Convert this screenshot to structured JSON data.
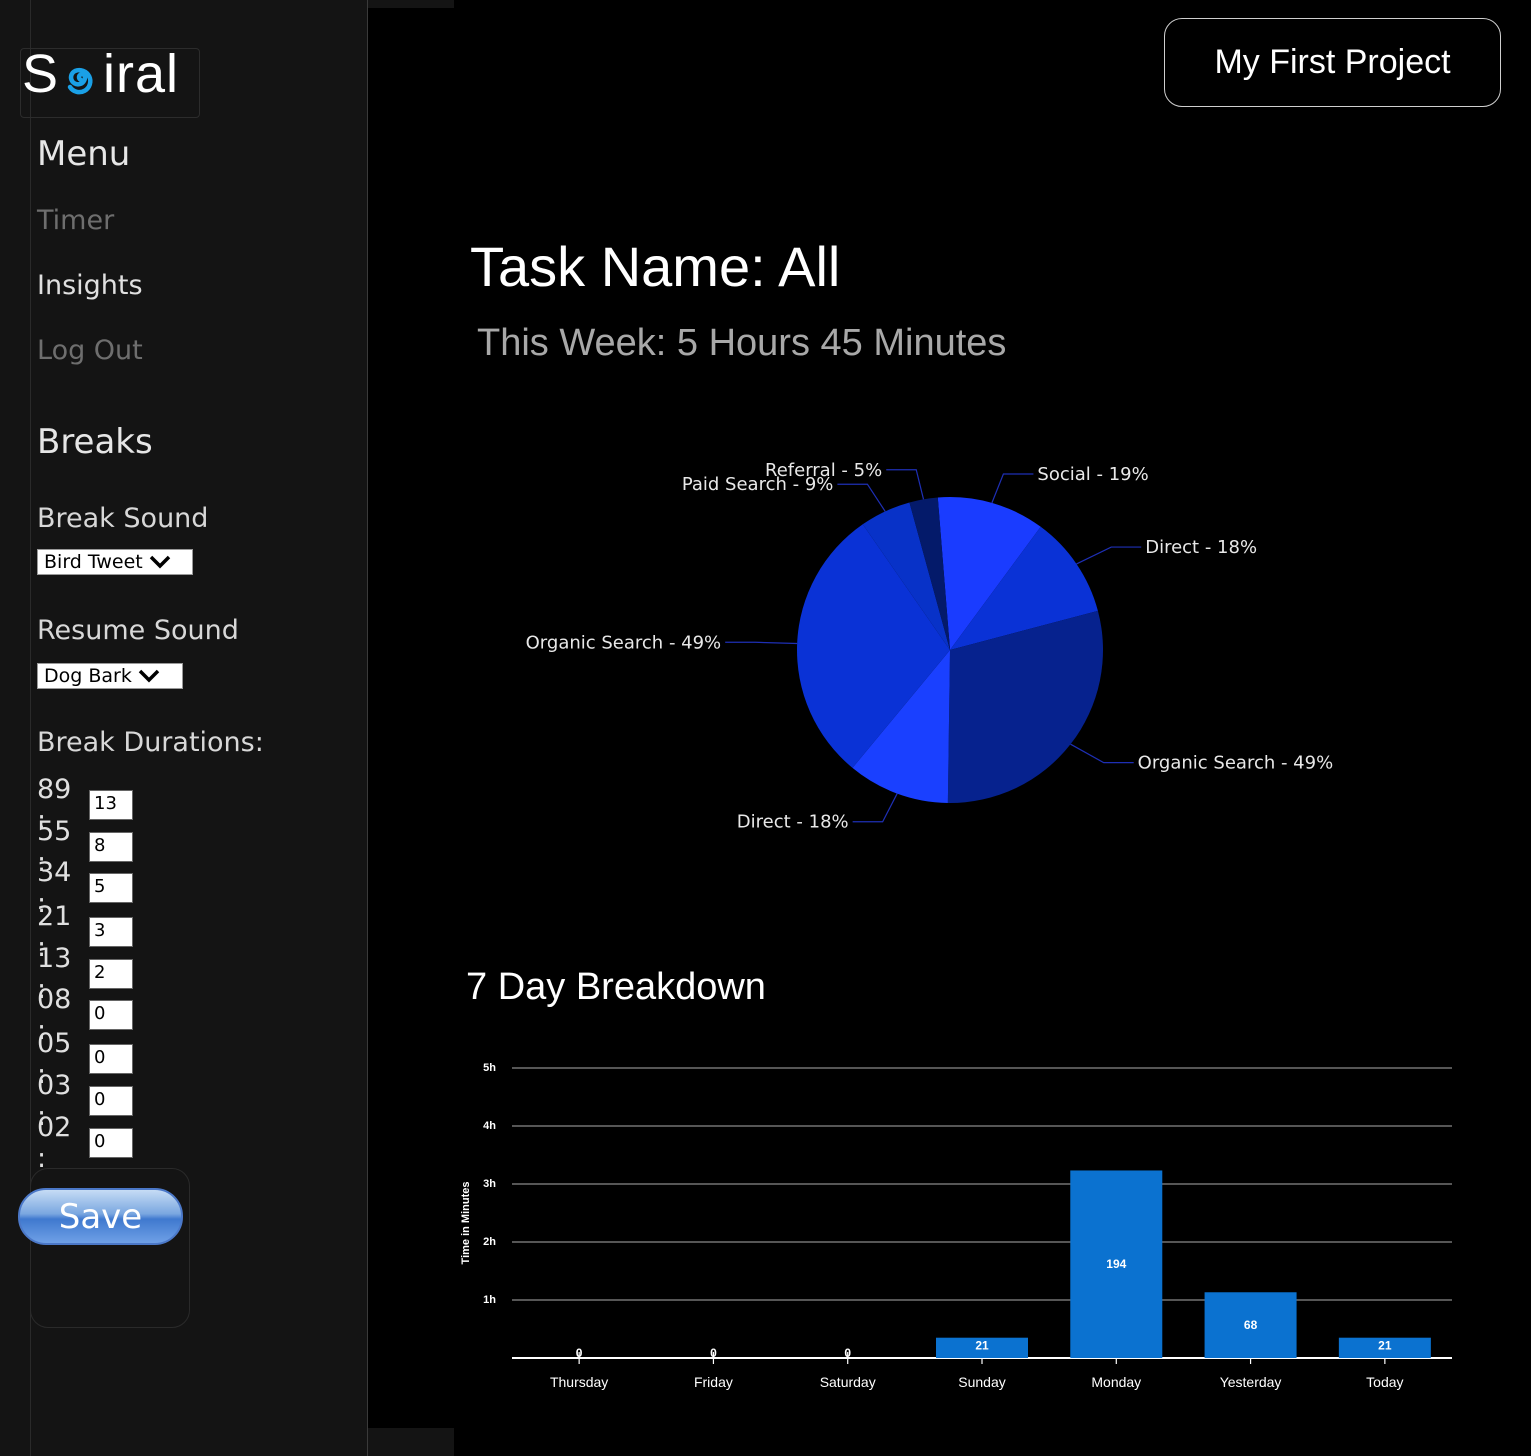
{
  "sidebar": {
    "logo_text": "Spiral",
    "menu_heading": "Menu",
    "menu_items": [
      {
        "label": "Timer",
        "active": false
      },
      {
        "label": "Insights",
        "active": true
      },
      {
        "label": "Log Out",
        "active": false
      }
    ],
    "breaks_heading": "Breaks",
    "break_sound_label": "Break Sound",
    "break_sound_value": "Bird Tweet",
    "resume_sound_label": "Resume Sound",
    "resume_sound_value": "Dog Bark",
    "durations_label": "Break Durations:",
    "durations": [
      {
        "label": "89 :",
        "value": "13"
      },
      {
        "label": "55 :",
        "value": "8"
      },
      {
        "label": "34 :",
        "value": "5"
      },
      {
        "label": "21 :",
        "value": "3"
      },
      {
        "label": "13 :",
        "value": "2"
      },
      {
        "label": "08 :",
        "value": "0"
      },
      {
        "label": "05 :",
        "value": "0"
      },
      {
        "label": "03 :",
        "value": "0"
      },
      {
        "label": "02 :",
        "value": "0"
      }
    ],
    "save_label": "Save"
  },
  "header": {
    "project_label": "My First Project"
  },
  "main": {
    "task_title": "Task Name: All",
    "week_total": "This Week: 5 Hours 45 Minutes",
    "breakdown_title": "7 Day Breakdown"
  },
  "colors": {
    "accent": "#1a73e8",
    "bar": "#0b72d0",
    "pie": [
      "#1a3cff",
      "#0a32d6",
      "#06228e",
      "#0832c8",
      "#041a6a",
      "#1a40ff"
    ]
  },
  "chart_data": [
    {
      "type": "pie",
      "slices": [
        {
          "label": "Social - 19%",
          "value": 19
        },
        {
          "label": "Direct - 18%",
          "value": 18
        },
        {
          "label": "Organic Search - 49%",
          "value": 49
        },
        {
          "label": "Direct - 18%",
          "value": 18
        },
        {
          "label": "Organic Search - 49%",
          "value": 49
        },
        {
          "label": "Paid Search - 9%",
          "value": 9
        },
        {
          "label": "Referral - 5%",
          "value": 5
        }
      ]
    },
    {
      "type": "bar",
      "categories": [
        "Thursday",
        "Friday",
        "Saturday",
        "Sunday",
        "Monday",
        "Yesterday",
        "Today"
      ],
      "values": [
        0,
        0,
        0,
        21,
        194,
        68,
        21
      ],
      "ylabel": "Time in Minutes",
      "yticks": [
        "1h",
        "2h",
        "3h",
        "4h",
        "5h"
      ],
      "ylim": [
        0,
        300
      ],
      "grid": true
    }
  ]
}
